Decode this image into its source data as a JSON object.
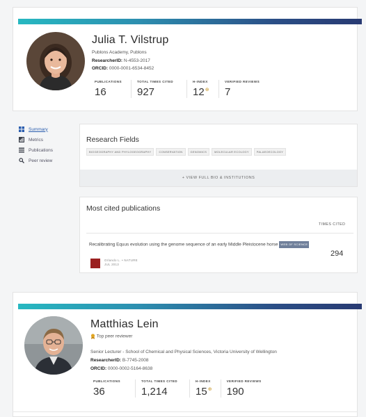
{
  "profile1": {
    "name": "Julia T. Vilstrup",
    "affiliation": "Publons Academy, Publons",
    "researcher_id_label": "ResearcherID:",
    "researcher_id": "N-4553-2017",
    "orcid_label": "ORCID:",
    "orcid": "0000-0001-6534-8452",
    "metrics": [
      {
        "label": "PUBLICATIONS",
        "value": "16",
        "sup": ""
      },
      {
        "label": "TOTAL TIMES CITED",
        "value": "927",
        "sup": ""
      },
      {
        "label": "H-INDEX",
        "value": "12",
        "sup": "⊕"
      },
      {
        "label": "VERIFIED REVIEWS",
        "value": "7",
        "sup": ""
      }
    ]
  },
  "sidenav": {
    "items": [
      {
        "label": "Summary",
        "icon": "summary-icon"
      },
      {
        "label": "Metrics",
        "icon": "metrics-icon"
      },
      {
        "label": "Publications",
        "icon": "publications-icon"
      },
      {
        "label": "Peer review",
        "icon": "search-icon"
      }
    ]
  },
  "research": {
    "title": "Research Fields",
    "tags": [
      "BIOGEOGRAPHY AND PHYLOGEOGRAPHY",
      "CONSERVATION",
      "GENOMICS",
      "MOLECULAR ECOLOGY",
      "PALAEOECOLOGY"
    ],
    "view_full": "+ VIEW FULL BIO & INSTITUTIONS"
  },
  "cited": {
    "title": "Most cited publications",
    "col_header": "TIMES CITED",
    "pub_title": "Recalibrating Equus evolution using the genome sequence of an early Middle Pleistocene horse",
    "wos_badge": "WEB OF SCIENCE",
    "journal": "Orlando L. • NATURE",
    "date": "JUL 2013",
    "times_cited": "294"
  },
  "profile2": {
    "name": "Matthias Lein",
    "badge": "Top peer reviewer",
    "affiliation": "Senior Lecturer - School of Chemical and Physical Sciences, Victoria University of Wellington",
    "researcher_id_label": "ResearcherID:",
    "researcher_id": "B-7745-2008",
    "orcid_label": "ORCID:",
    "orcid": "0000-0002-5164-8638",
    "metrics": [
      {
        "label": "PUBLICATIONS",
        "value": "36",
        "sup": ""
      },
      {
        "label": "TOTAL TIMES CITED",
        "value": "1,214",
        "sup": ""
      },
      {
        "label": "H-INDEX",
        "value": "15",
        "sup": "⊕"
      },
      {
        "label": "VERIFIED REVIEWS",
        "value": "190",
        "sup": ""
      }
    ]
  },
  "colors": {
    "accent_teal": "#27b8c1",
    "accent_navy": "#283a72",
    "link_blue": "#2a5dae"
  }
}
